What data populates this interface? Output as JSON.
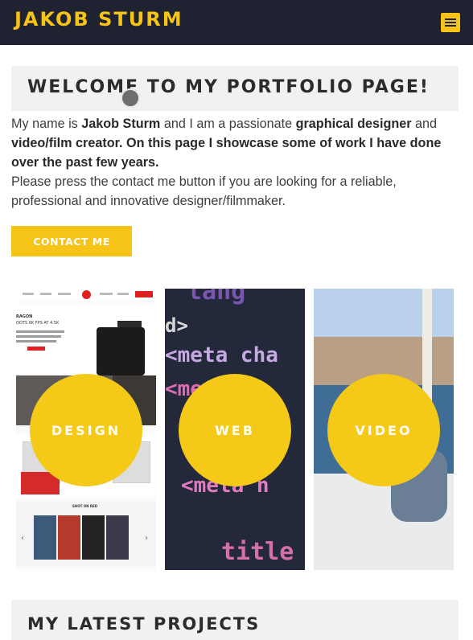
{
  "header": {
    "brand": "JAKOB STURM",
    "menu_icon": "hamburger-menu-icon",
    "background": "#1f2230",
    "accent": "#f6c417"
  },
  "welcome": {
    "title": "WELCOME TO MY PORTFOLIO PAGE!"
  },
  "intro": {
    "p1_a": "My name is ",
    "p1_name": "Jakob Sturm",
    "p1_b": " and I am a passionate ",
    "p1_role": "graphical designer",
    "p1_c": " and ",
    "p1_bold_rest": "video/film creator. On this page I showcase some of work I have done over the past few years.",
    "p2": "Please press the contact me button if you are looking for a reliable, professional and innovative designer/filmmaker."
  },
  "contact_button": {
    "label": "CONTACT ME"
  },
  "categories": [
    {
      "label": "DESIGN"
    },
    {
      "label": "WEB"
    },
    {
      "label": "VIDEO"
    }
  ],
  "web_code_lines": [
    "tang",
    "d>",
    "<meta cha",
    "<meta",
    "<meta n",
    "title"
  ],
  "design_preview": {
    "hero_text": "RAGON",
    "hero_sub": "OOTS 6K FPS AT 4.5K",
    "shot_on_red": "SHOT ON RED"
  },
  "projects": {
    "title": "MY LATEST PROJECTS"
  }
}
